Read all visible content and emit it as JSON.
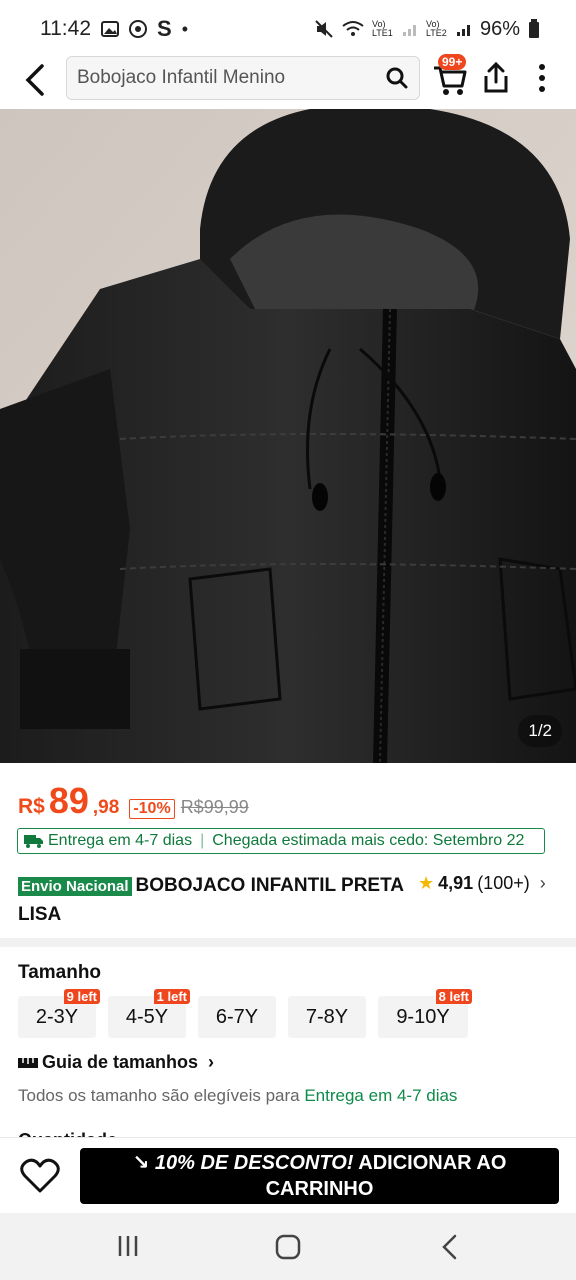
{
  "status_bar": {
    "time": "11:42",
    "battery": "96%",
    "sim1": "Vo) LTE1",
    "sim2": "Vo) LTE2"
  },
  "search": {
    "query": "Bobojaco Infantil Menino"
  },
  "cart": {
    "badge": "99+"
  },
  "gallery": {
    "counter": "1/2"
  },
  "price": {
    "currency": "R$",
    "integer": "89",
    "decimal": ",98",
    "discount": "-10%",
    "original": "R$99,99"
  },
  "delivery": {
    "label": "Entrega em 4-7 dias",
    "estimate": "Chegada estimada mais cedo: Setembro 22"
  },
  "product": {
    "tag": "Envio Nacional",
    "title": "BOBOJACO INFANTIL PRETA LISA",
    "rating": "4,91",
    "reviews": "(100+)"
  },
  "size": {
    "label": "Tamanho",
    "options": [
      {
        "label": "2-3Y",
        "badge": "9 left"
      },
      {
        "label": "4-5Y",
        "badge": "1 left"
      },
      {
        "label": "6-7Y",
        "badge": ""
      },
      {
        "label": "7-8Y",
        "badge": ""
      },
      {
        "label": "9-10Y",
        "badge": "8 left"
      }
    ],
    "guide": "Guia de tamanhos",
    "note_prefix": "Todos os tamanho são elegíveis para ",
    "note_link": "Entrega em 4-7 dias"
  },
  "qty_peek": "Quantidade",
  "cta": {
    "promo": "10% DE DESCONTO!",
    "action": "ADICIONAR AO CARRINHO"
  },
  "colors": {
    "accent": "#f04a1a",
    "green": "#1a8a4a",
    "button": "#000000"
  }
}
